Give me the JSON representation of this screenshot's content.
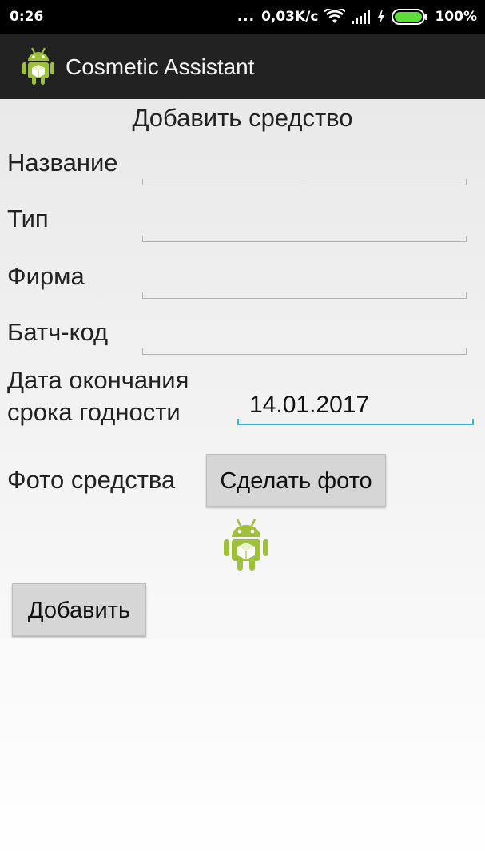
{
  "status_bar": {
    "time": "0:26",
    "dots": "...",
    "network_speed": "0,03K/c",
    "battery_percent": "100%",
    "icons": [
      "wifi-icon",
      "signal-icon",
      "charging-bolt-icon",
      "battery-icon"
    ]
  },
  "app_bar": {
    "title": "Cosmetic Assistant",
    "logo": "android-logo-icon"
  },
  "form": {
    "title": "Добавить средство",
    "name_label": "Название",
    "type_label": "Тип",
    "brand_label": "Фирма",
    "batch_label": "Батч-код",
    "expiry_label_line1": "Дата окончания",
    "expiry_label_line2": "срока годности",
    "expiry_value": "14.01.2017",
    "photo_label": "Фото средства",
    "photo_button": "Сделать фото",
    "photo_placeholder": "android-product-icon",
    "submit_button": "Добавить"
  },
  "colors": {
    "status_bar_bg": "#000000",
    "app_bar_bg": "#222222",
    "focus_accent": "#33b5e5",
    "android_green": "#9fc03b",
    "battery_green": "#5ddc3a"
  }
}
